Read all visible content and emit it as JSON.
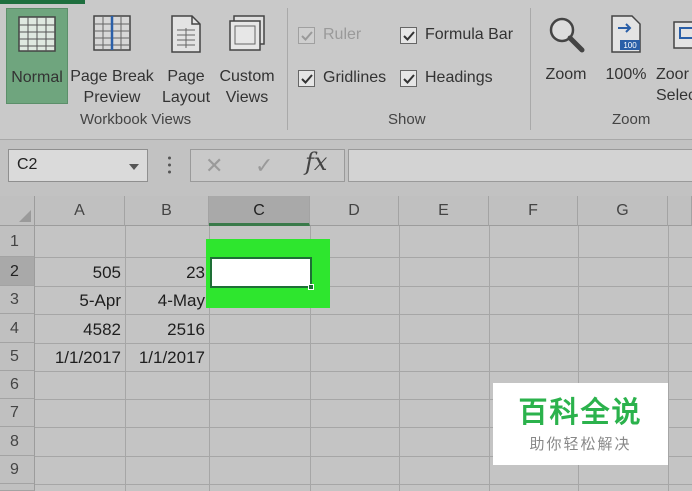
{
  "ribbon": {
    "workbook_views": {
      "label": "Workbook Views",
      "normal": "Normal",
      "page_break_1": "Page Break",
      "page_break_2": "Preview",
      "page_layout_1": "Page",
      "page_layout_2": "Layout",
      "custom_views_1": "Custom",
      "custom_views_2": "Views"
    },
    "show": {
      "label": "Show",
      "ruler": "Ruler",
      "formula_bar": "Formula Bar",
      "gridlines": "Gridlines",
      "headings": "Headings"
    },
    "zoom": {
      "label": "Zoom",
      "zoom": "Zoom",
      "zoom_100": "100%",
      "zoom_sel_1": "Zoor",
      "zoom_sel_2": "Selec"
    }
  },
  "formula_bar": {
    "name_box": "C2",
    "cancel": "✕",
    "enter": "✓",
    "fx": "fx",
    "value": ""
  },
  "grid": {
    "columns": [
      "A",
      "B",
      "C",
      "D",
      "E",
      "F",
      "G"
    ],
    "rows": [
      "1",
      "2",
      "3",
      "4",
      "5",
      "6",
      "7",
      "8",
      "9"
    ],
    "cells": {
      "A2": "505",
      "B2": "23",
      "A3": "5-Apr",
      "B3": "4-May",
      "A4": "4582",
      "B4": "2516",
      "A5": "1/1/2017",
      "B5": "1/1/2017"
    },
    "selected_cell": "C2"
  },
  "watermark": {
    "title": "百科全说",
    "subtitle": "助你轻松解决"
  },
  "colors": {
    "accent": "#1e6f36",
    "highlight": "#2ee62e",
    "watermark_green": "#2bb24c"
  }
}
